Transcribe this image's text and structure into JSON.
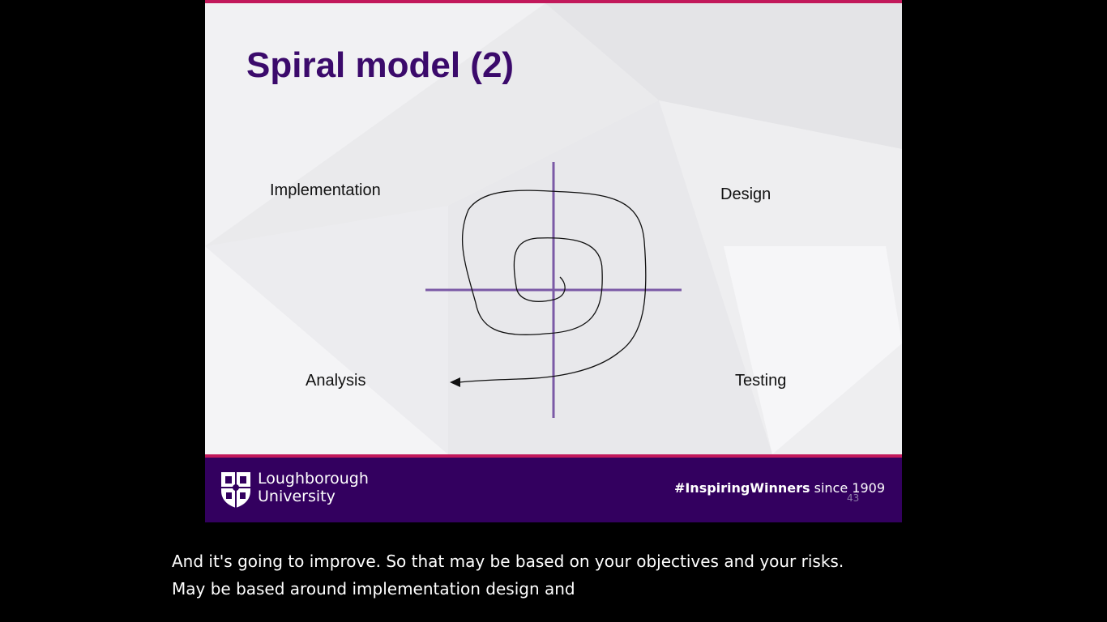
{
  "slide": {
    "title": "Spiral model (2)",
    "quadrants": {
      "implementation": "Implementation",
      "design": "Design",
      "analysis": "Analysis",
      "testing": "Testing"
    },
    "footer": {
      "university_line1": "Loughborough",
      "university_line2": "University",
      "tagline_hashtag": "#InspiringWinners",
      "tagline_rest": " since 1909",
      "slide_number": "43"
    }
  },
  "captions": {
    "line1": "And it's going to improve. So that may be based on your objectives and your risks.",
    "line2": "May be based around implementation design and"
  },
  "colors": {
    "title": "#3b0a6b",
    "footer_bg": "#33005f",
    "accent_bar": "#c2185b",
    "axis": "#7b5aa6"
  },
  "icons": {
    "crest": "loughborough-crest-icon"
  }
}
